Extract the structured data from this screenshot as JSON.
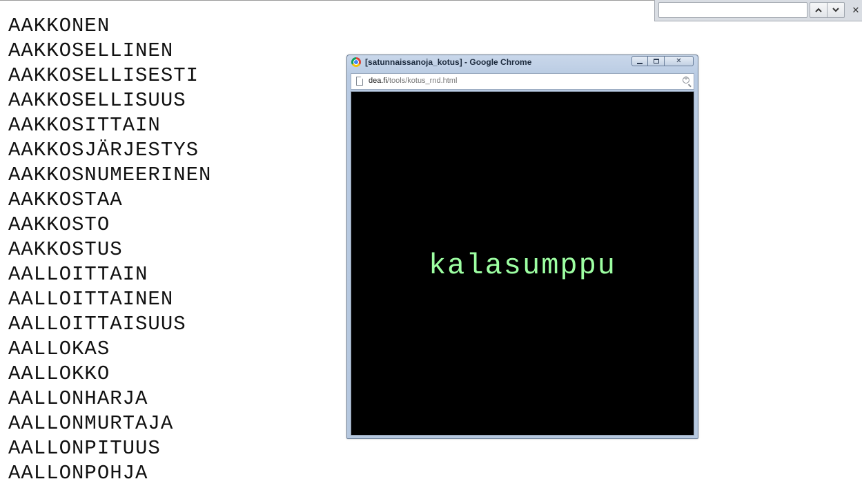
{
  "word_list": [
    "AAKKONEN",
    "AAKKOSELLINEN",
    "AAKKOSELLISESTI",
    "AAKKOSELLISUUS",
    "AAKKOSITTAIN",
    "AAKKOSJÄRJESTYS",
    "AAKKOSNUMEERINEN",
    "AAKKOSTAA",
    "AAKKOSTO",
    "AAKKOSTUS",
    "AALLOITTAIN",
    "AALLOITTAINEN",
    "AALLOITTAISUUS",
    "AALLOKAS",
    "AALLOKKO",
    "AALLONHARJA",
    "AALLONMURTAJA",
    "AALLONPITUUS",
    "AALLONPOHJA"
  ],
  "find_bar": {
    "query": "",
    "prev_icon": "chevron-up-icon",
    "next_icon": "chevron-down-icon",
    "close_label": "✕"
  },
  "popup": {
    "window_title": "[satunnaissanoja_kotus] - Google Chrome",
    "url_host": "dea.fi",
    "url_path": "/tools/kotus_rnd.html",
    "random_word": "kalasumppu",
    "random_word_color": "#9dffa2",
    "background_color": "#000000",
    "close_label": "✕"
  }
}
